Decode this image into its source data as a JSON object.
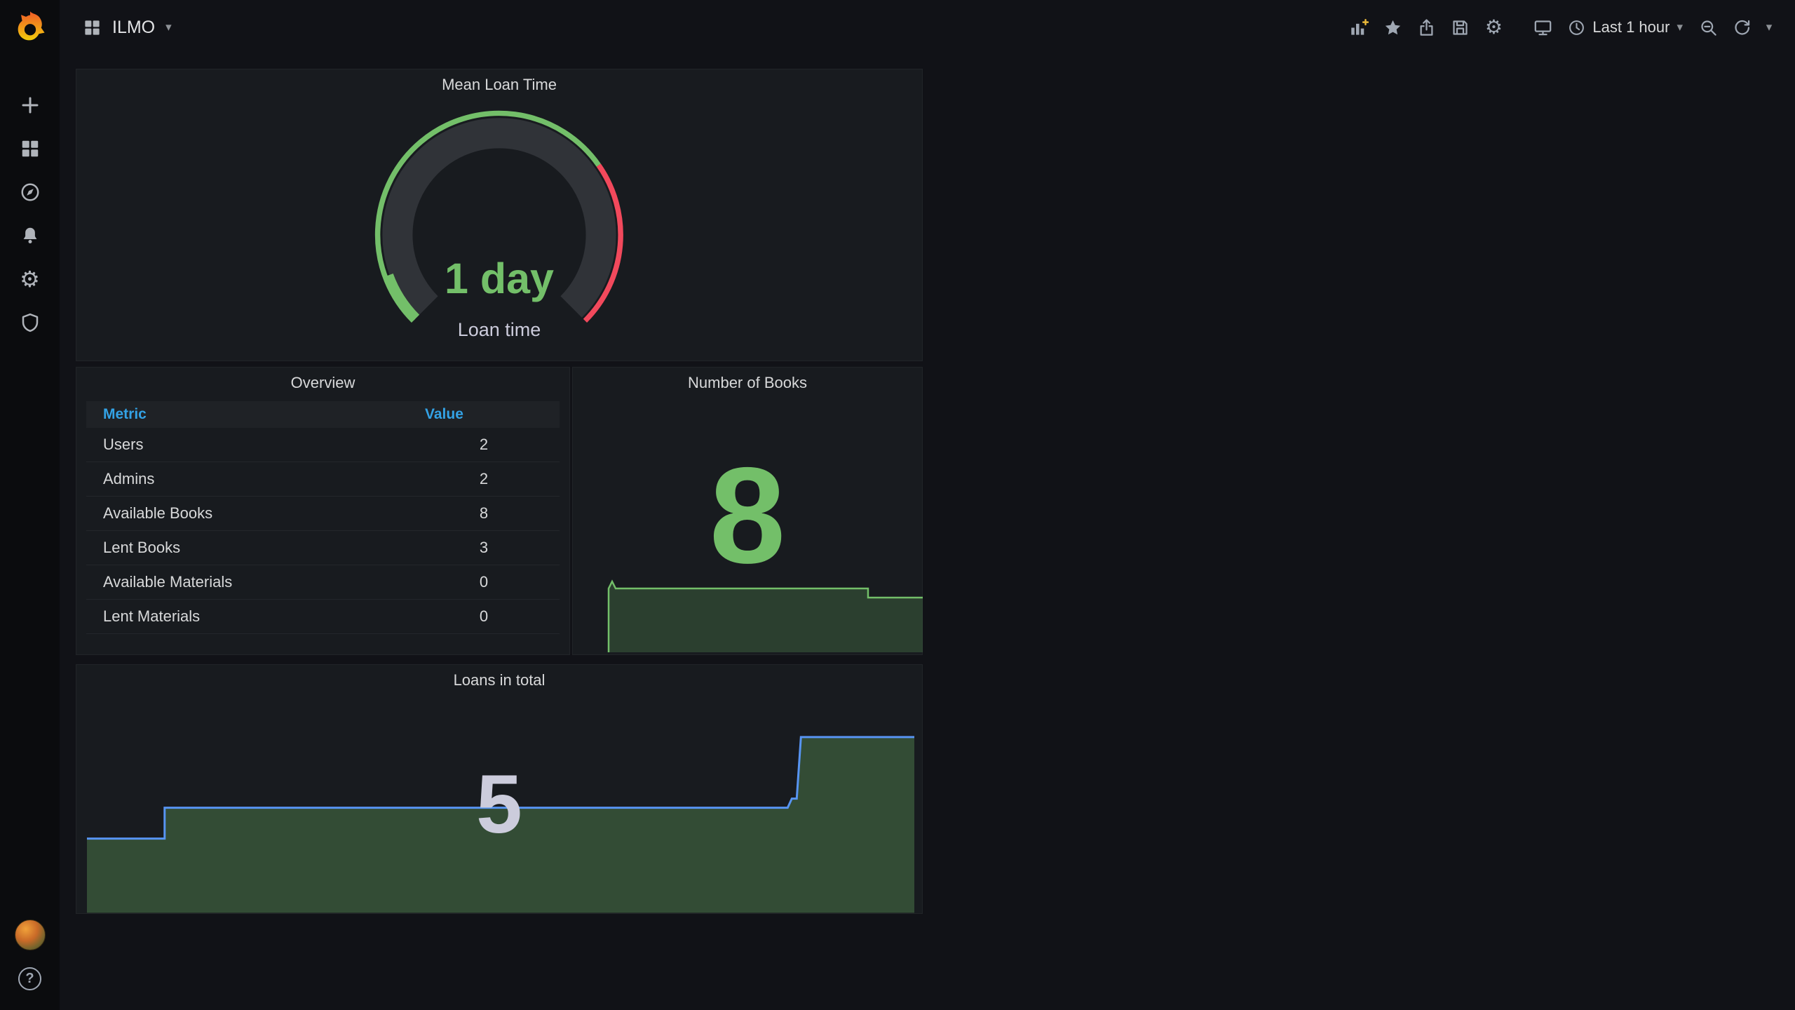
{
  "topnav": {
    "dashboard_title": "ILMO",
    "time_picker_label": "Last 1 hour"
  },
  "icons": {
    "gear": "⚙",
    "caret_down": "▾",
    "question_mark": "?"
  },
  "panels": {
    "mean_loan_time": {
      "title": "Mean Loan Time",
      "value_text": "1 day",
      "label": "Loan time"
    },
    "overview": {
      "title": "Overview",
      "columns": {
        "metric": "Metric",
        "value": "Value"
      },
      "rows": [
        {
          "metric": "Users",
          "value": "2"
        },
        {
          "metric": "Admins",
          "value": "2"
        },
        {
          "metric": "Available Books",
          "value": "8"
        },
        {
          "metric": "Lent Books",
          "value": "3"
        },
        {
          "metric": "Available Materials",
          "value": "0"
        },
        {
          "metric": "Lent Materials",
          "value": "0"
        }
      ]
    },
    "number_of_books": {
      "title": "Number of Books",
      "value": "8"
    },
    "loans_in_total": {
      "title": "Loans in total",
      "value": "5"
    }
  },
  "colors": {
    "green": "#73bf69",
    "red": "#f2495c",
    "line_blue": "#5794f2",
    "table_header_blue": "#33a2e5",
    "panel_bg": "#181b1f",
    "page_bg": "#111217",
    "sidebar_bg": "#0b0c0e"
  },
  "chart_data": [
    {
      "type": "gauge",
      "title": "Mean Loan Time",
      "value": 1,
      "unit": "day",
      "value_text": "1 day",
      "label": "Loan time",
      "thresholds": [
        {
          "color": "#73bf69"
        },
        {
          "color": "#f2495c"
        }
      ]
    },
    {
      "type": "table",
      "title": "Overview",
      "columns": [
        "Metric",
        "Value"
      ],
      "rows": [
        [
          "Users",
          2
        ],
        [
          "Admins",
          2
        ],
        [
          "Available Books",
          8
        ],
        [
          "Lent Books",
          3
        ],
        [
          "Available Materials",
          0
        ],
        [
          "Lent Materials",
          0
        ]
      ]
    },
    {
      "type": "area",
      "title": "Number of Books",
      "current_value": 8,
      "approx_series": [
        8,
        9,
        8,
        8,
        8,
        8,
        7,
        7
      ],
      "line_color": "#73bf69"
    },
    {
      "type": "area",
      "title": "Loans in total",
      "current_value": 5,
      "approx_series": [
        2,
        3,
        3,
        3,
        3,
        3,
        5,
        5
      ],
      "line_color": "#5794f2"
    }
  ]
}
